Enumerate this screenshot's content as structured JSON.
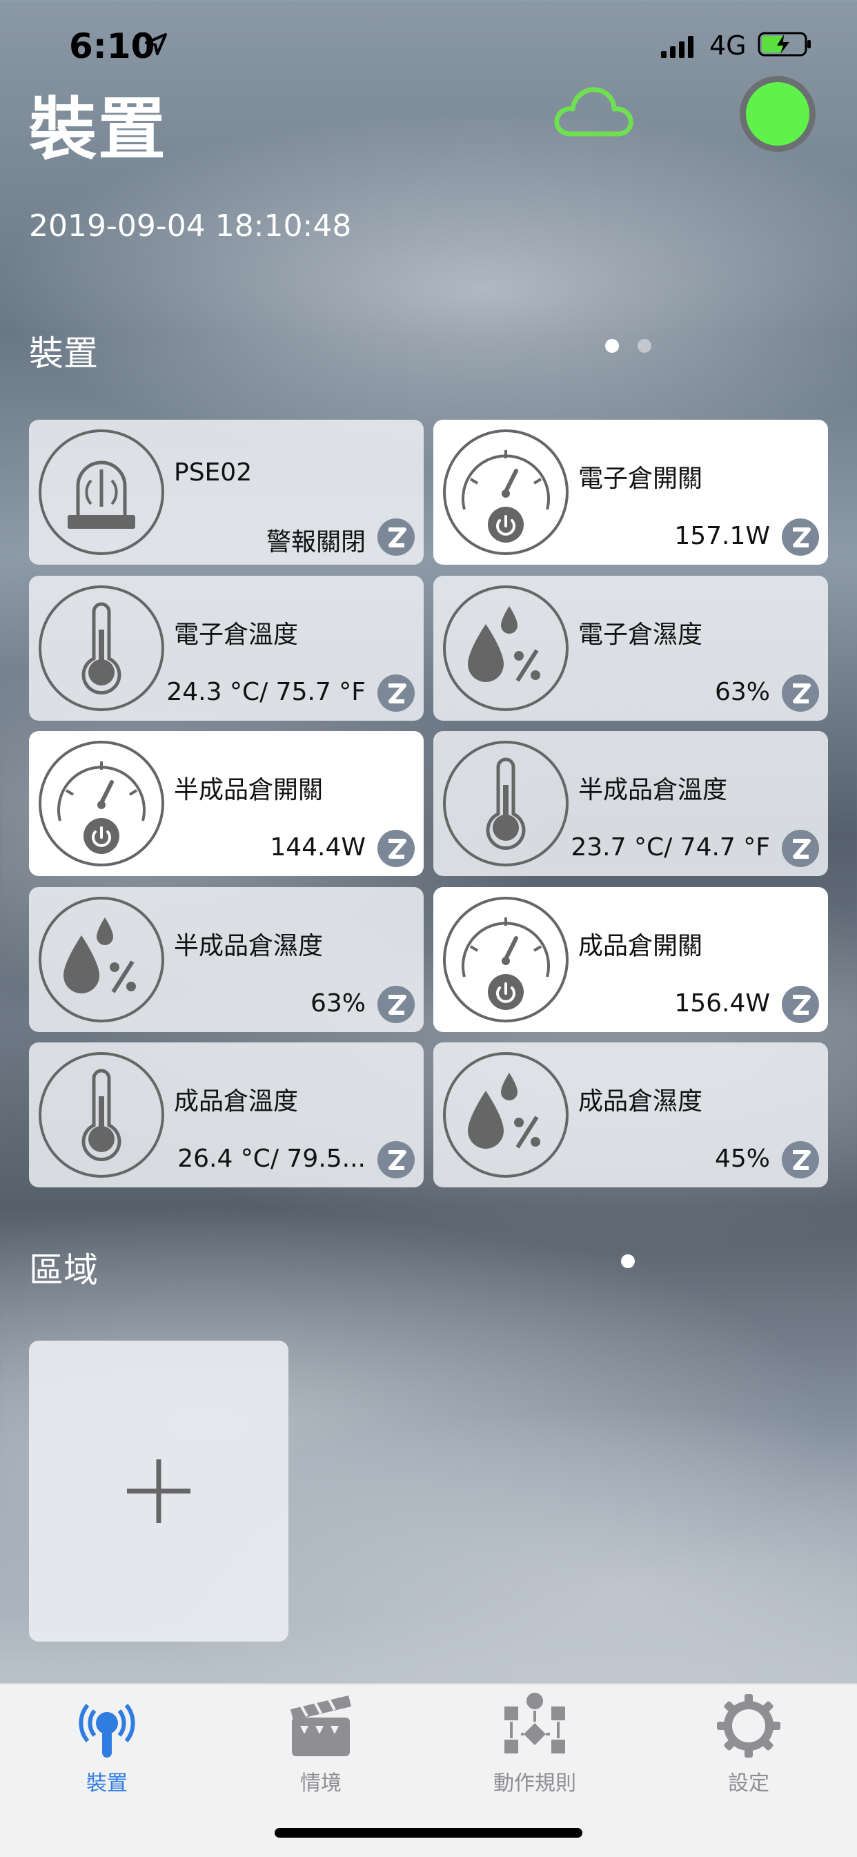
{
  "status_bar": {
    "time": "6:10",
    "network": "4G",
    "icons": [
      "location-arrow-icon",
      "signal-icon",
      "battery-charging-icon"
    ]
  },
  "header": {
    "title": "裝置",
    "timestamp": "2019-09-04 18:10:48",
    "cloud_color": "#6fe052",
    "status_color": "#5ef24a"
  },
  "devices_section": {
    "label": "裝置",
    "page_count": 2,
    "active_page": 1,
    "cards": [
      {
        "name": "PSE02",
        "value": "警報關閉",
        "icon": "alarm-siren-icon",
        "on": false
      },
      {
        "name": "電子倉開關",
        "value": "157.1W",
        "icon": "power-meter-icon",
        "on": true
      },
      {
        "name": "電子倉溫度",
        "value": "24.3 °C/ 75.7 °F",
        "icon": "thermometer-icon",
        "on": false
      },
      {
        "name": "電子倉濕度",
        "value": "63%",
        "icon": "humidity-icon",
        "on": false
      },
      {
        "name": "半成品倉開關",
        "value": "144.4W",
        "icon": "power-meter-icon",
        "on": true
      },
      {
        "name": "半成品倉溫度",
        "value": "23.7 °C/ 74.7 °F",
        "icon": "thermometer-icon",
        "on": false
      },
      {
        "name": "半成品倉濕度",
        "value": "63%",
        "icon": "humidity-icon",
        "on": false
      },
      {
        "name": "成品倉開關",
        "value": "156.4W",
        "icon": "power-meter-icon",
        "on": true
      },
      {
        "name": "成品倉溫度",
        "value": "26.4 °C/ 79.5...",
        "icon": "thermometer-icon",
        "on": false
      },
      {
        "name": "成品倉濕度",
        "value": "45%",
        "icon": "humidity-icon",
        "on": false
      }
    ]
  },
  "areas_section": {
    "label": "區域",
    "page_count": 1,
    "add_icon": "plus-icon"
  },
  "tabbar": {
    "tabs": [
      {
        "label": "裝置",
        "icon": "antenna-icon",
        "active": true
      },
      {
        "label": "情境",
        "icon": "clapperboard-icon",
        "active": false
      },
      {
        "label": "動作規則",
        "icon": "flowchart-icon",
        "active": false
      },
      {
        "label": "設定",
        "icon": "gear-icon",
        "active": false
      }
    ],
    "active_color": "#2f7de1",
    "inactive_color": "#8e8e93"
  }
}
